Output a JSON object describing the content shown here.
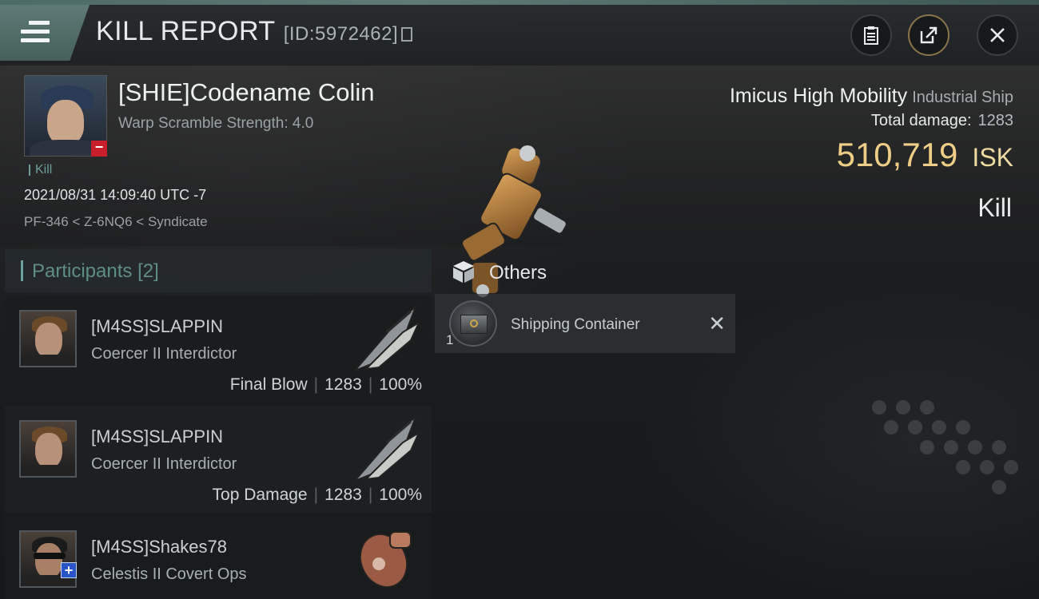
{
  "header": {
    "title": "KILL REPORT",
    "report_id": "[ID:5972462]"
  },
  "victim": {
    "name": "[SHIE]Codename Colin",
    "warp_scramble": "Warp Scramble Strength: 4.0",
    "tag": "Kill",
    "datetime": "2021/08/31 14:09:40 UTC -7",
    "location": "PF-346 < Z-6NQ6 < Syndicate"
  },
  "ship": {
    "name": "Imicus High Mobility",
    "class": "Industrial Ship",
    "total_damage_label": "Total damage:",
    "total_damage_value": "1283",
    "isk_value": "510,719",
    "isk_unit": "ISK",
    "result": "Kill"
  },
  "participants": {
    "title": "Participants",
    "count": "[2]",
    "rows": [
      {
        "name": "[M4SS]SLAPPIN",
        "ship": "Coercer II Interdictor",
        "role": "Final Blow",
        "damage": "1283",
        "percent": "100%"
      },
      {
        "name": "[M4SS]SLAPPIN",
        "ship": "Coercer II Interdictor",
        "role": "Top Damage",
        "damage": "1283",
        "percent": "100%"
      },
      {
        "name": "[M4SS]Shakes78",
        "ship": "Celestis II Covert Ops"
      }
    ]
  },
  "others": {
    "title": "Others",
    "items": [
      {
        "name": "Shipping Container",
        "quantity": "1"
      }
    ]
  },
  "colors": {
    "accent_teal": "#5f7a76",
    "isk_gold": "#f0cd86",
    "minus_red": "#c8202b",
    "plus_blue": "#2a55c8"
  },
  "icons": [
    "menu-icon",
    "copy-icon",
    "clipboard-icon",
    "share-icon",
    "close-icon",
    "cube-icon",
    "remove-icon"
  ]
}
